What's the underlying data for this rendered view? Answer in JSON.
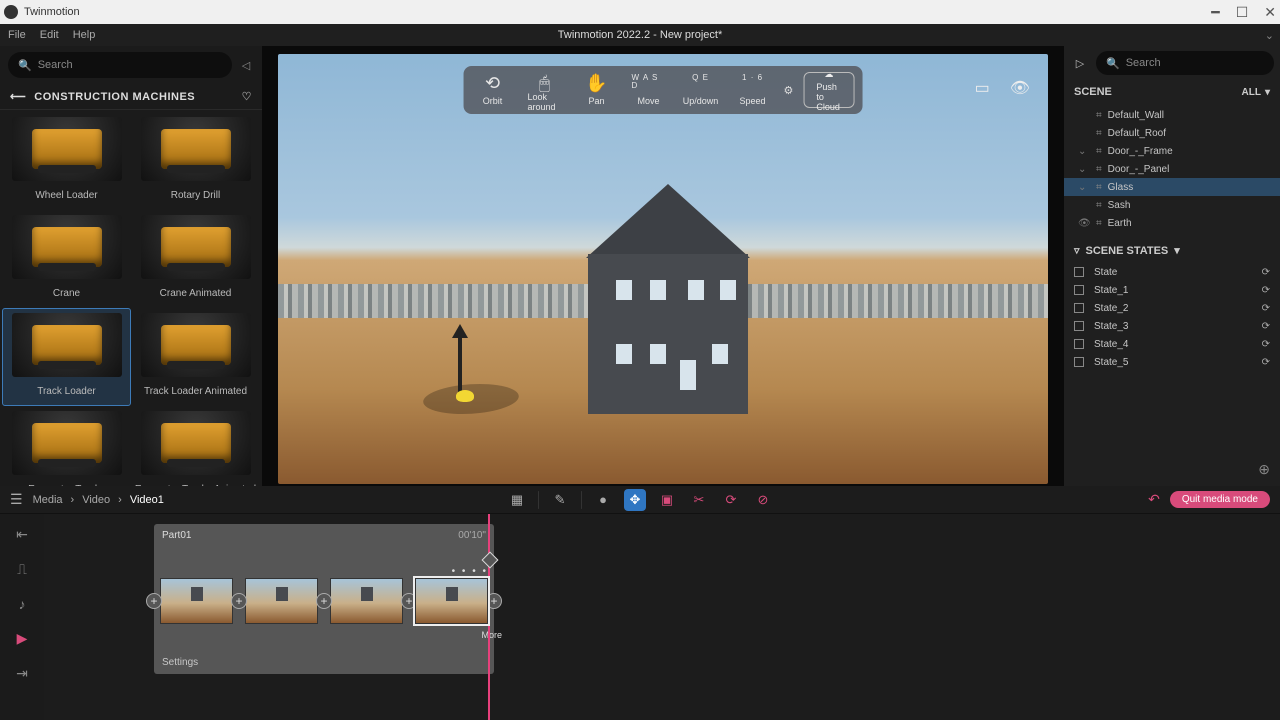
{
  "window": {
    "app_name": "Twinmotion",
    "title": "Twinmotion 2022.2 - New project*"
  },
  "menubar": [
    "File",
    "Edit",
    "Help"
  ],
  "left": {
    "search_placeholder": "Search",
    "category": "CONSTRUCTION MACHINES",
    "assets": [
      {
        "label": "Wheel Loader"
      },
      {
        "label": "Rotary Drill"
      },
      {
        "label": "Crane"
      },
      {
        "label": "Crane Animated"
      },
      {
        "label": "Track Loader",
        "selected": true
      },
      {
        "label": "Track Loader Animated"
      },
      {
        "label": "Excavator Tracks"
      },
      {
        "label": "Excavator Tracks Animated"
      }
    ]
  },
  "viewport": {
    "nav": [
      {
        "label": "Orbit"
      },
      {
        "label": "Look around"
      },
      {
        "label": "Move",
        "keys": "W A S D"
      },
      {
        "label": "Up/down",
        "keys": "Q E"
      },
      {
        "label": "Speed",
        "keys": "1 · 6"
      }
    ],
    "push_cloud": "Push to Cloud"
  },
  "right": {
    "search_placeholder": "Search",
    "scene_label": "SCENE",
    "filter": "ALL",
    "tree": [
      {
        "name": "Default_Wall"
      },
      {
        "name": "Default_Roof"
      },
      {
        "name": "Door_-_Frame"
      },
      {
        "name": "Door_-_Panel"
      },
      {
        "name": "Glass",
        "selected": true
      },
      {
        "name": "Sash"
      },
      {
        "name": "Earth"
      }
    ],
    "states_label": "SCENE STATES",
    "states": [
      "State",
      "State_1",
      "State_2",
      "State_3",
      "State_4",
      "State_5"
    ]
  },
  "bottom": {
    "crumbs": [
      "Media",
      "Video",
      "Video1"
    ],
    "quit": "Quit media mode",
    "part": {
      "name": "Part01",
      "duration": "00'10\""
    },
    "more": "More",
    "settings": "Settings"
  }
}
